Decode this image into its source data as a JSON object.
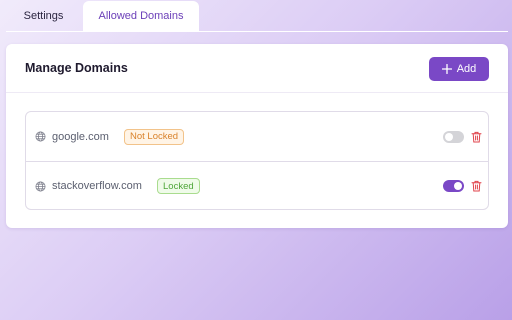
{
  "tabs": [
    {
      "label": "Settings",
      "active": false
    },
    {
      "label": "Allowed Domains",
      "active": true
    }
  ],
  "card": {
    "title": "Manage Domains",
    "add_label": "Add"
  },
  "domains": [
    {
      "name": "google.com",
      "status": "Not Locked",
      "enabled": false
    },
    {
      "name": "stackoverflow.com",
      "status": "Locked",
      "enabled": true
    }
  ],
  "colors": {
    "accent": "#7a48c6",
    "not_locked": "#d9822b",
    "locked": "#4fa63a",
    "delete": "#e0434b"
  },
  "icons": {
    "add": "plus-icon",
    "domain": "globe-icon",
    "delete": "trash-icon"
  }
}
